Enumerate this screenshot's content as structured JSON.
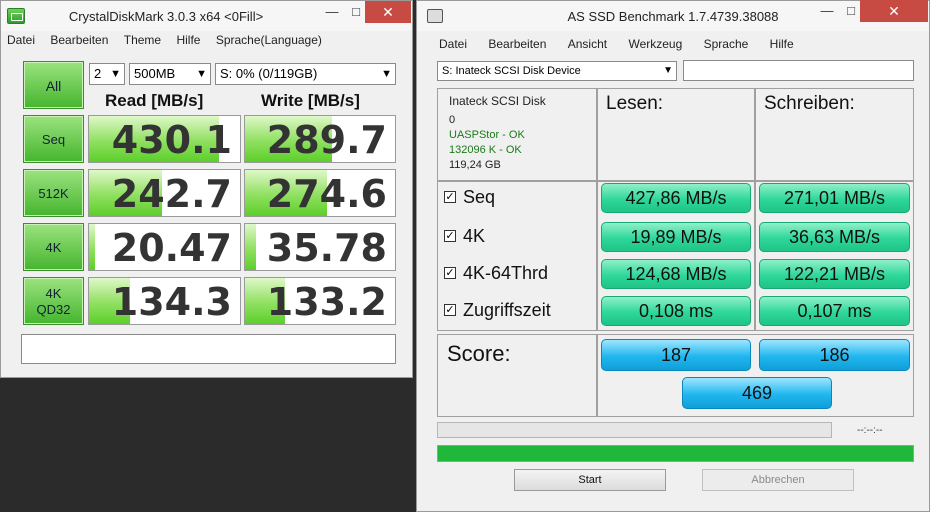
{
  "cdm": {
    "title": "CrystalDiskMark 3.0.3 x64 <0Fill>",
    "window_controls": {
      "minimize": "—",
      "maximize": "□",
      "close": "✕"
    },
    "menu": [
      "Datei",
      "Bearbeiten",
      "Theme",
      "Hilfe",
      "Sprache(Language)"
    ],
    "all_label": "All",
    "count_value": "2",
    "size_value": "500MB",
    "drive_value": "S: 0% (0/119GB)",
    "read_header": "Read [MB/s]",
    "write_header": "Write [MB/s]",
    "max_speed": 500,
    "rows": [
      {
        "label": "Seq",
        "label2": "",
        "read": "430.1",
        "write": "289.7"
      },
      {
        "label": "512K",
        "label2": "",
        "read": "242.7",
        "write": "274.6"
      },
      {
        "label": "4K",
        "label2": "",
        "read": "20.47",
        "write": "35.78"
      },
      {
        "label": "4K",
        "label2": "QD32",
        "read": "134.3",
        "write": "133.2"
      }
    ]
  },
  "asssd": {
    "title": "AS SSD Benchmark 1.7.4739.38088",
    "window_controls": {
      "minimize": "—",
      "maximize": "□",
      "close": "✕"
    },
    "menu": [
      "Datei",
      "Bearbeiten",
      "Ansicht",
      "Werkzeug",
      "Sprache",
      "Hilfe"
    ],
    "drive_select": "S: Inateck  SCSI Disk Device",
    "info": {
      "name": "Inateck  SCSI Disk",
      "line0": "0",
      "driver": "UASPStor - OK",
      "align": "132096 K - OK",
      "size": "119,24 GB"
    },
    "read_header": "Lesen:",
    "write_header": "Schreiben:",
    "rows": [
      {
        "label": "Seq",
        "checked": "✓",
        "read": "427,86 MB/s",
        "write": "271,01 MB/s"
      },
      {
        "label": "4K",
        "checked": "✓",
        "read": "19,89 MB/s",
        "write": "36,63 MB/s"
      },
      {
        "label": "4K-64Thrd",
        "checked": "✓",
        "read": "124,68 MB/s",
        "write": "122,21 MB/s"
      },
      {
        "label": "Zugriffszeit",
        "checked": "✓",
        "read": "0,108 ms",
        "write": "0,107 ms"
      }
    ],
    "score_label": "Score:",
    "score_read": "187",
    "score_write": "186",
    "score_total": "469",
    "progress_time": "--:--:--",
    "progress_total_fraction": 1.0,
    "start_label": "Start",
    "cancel_label": "Abbrechen",
    "accent_green": "#1fb83a",
    "accent_teal": "#2fd79a",
    "accent_blue": "#21b6ee"
  }
}
